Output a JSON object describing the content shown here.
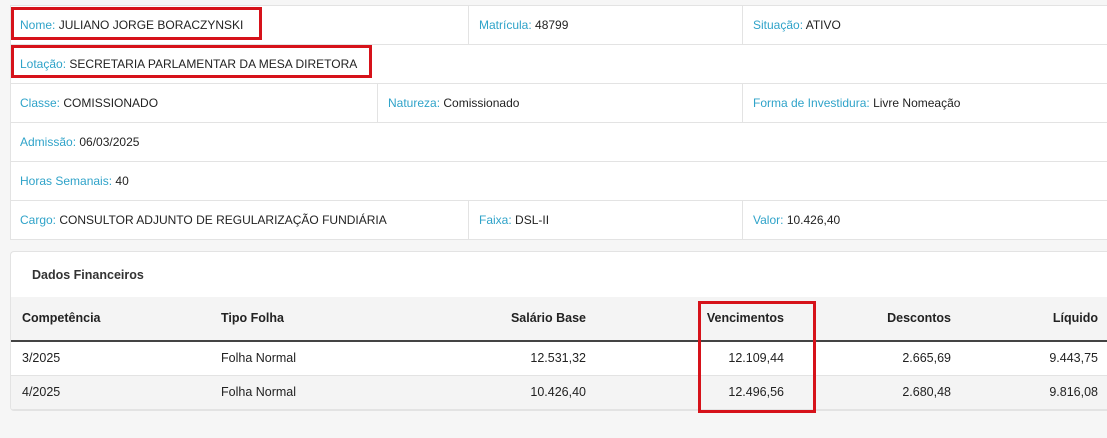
{
  "servidor": {
    "nome": {
      "label": "Nome:",
      "value": "JULIANO JORGE BORACZYNSKI"
    },
    "matricula": {
      "label": "Matrícula:",
      "value": "48799"
    },
    "situacao": {
      "label": "Situação:",
      "value": "ATIVO"
    },
    "lotacao": {
      "label": "Lotação:",
      "value": "SECRETARIA PARLAMENTAR DA MESA DIRETORA"
    },
    "classe": {
      "label": "Classe:",
      "value": "COMISSIONADO"
    },
    "natureza": {
      "label": "Natureza:",
      "value": "Comissionado"
    },
    "forma_investidura": {
      "label": "Forma de Investidura:",
      "value": "Livre Nomeação"
    },
    "admissao": {
      "label": "Admissão:",
      "value": "06/03/2025"
    },
    "horas_semanais": {
      "label": "Horas Semanais:",
      "value": "40"
    },
    "cargo": {
      "label": "Cargo:",
      "value": "CONSULTOR ADJUNTO DE REGULARIZAÇÃO FUNDIÁRIA"
    },
    "faixa": {
      "label": "Faixa:",
      "value": "DSL-II"
    },
    "valor": {
      "label": "Valor:",
      "value": "10.426,40"
    }
  },
  "financeiro": {
    "title": "Dados Financeiros",
    "columns": [
      "Competência",
      "Tipo Folha",
      "Salário Base",
      "Vencimentos",
      "Descontos",
      "Líquido"
    ],
    "rows": [
      [
        "3/2025",
        "Folha Normal",
        "12.531,32",
        "12.109,44",
        "2.665,69",
        "9.443,75"
      ],
      [
        "4/2025",
        "Folha Normal",
        "10.426,40",
        "12.496,56",
        "2.680,48",
        "9.816,08"
      ]
    ]
  },
  "colors": {
    "label": "#2fa3c9",
    "highlight": "#d6121a"
  }
}
